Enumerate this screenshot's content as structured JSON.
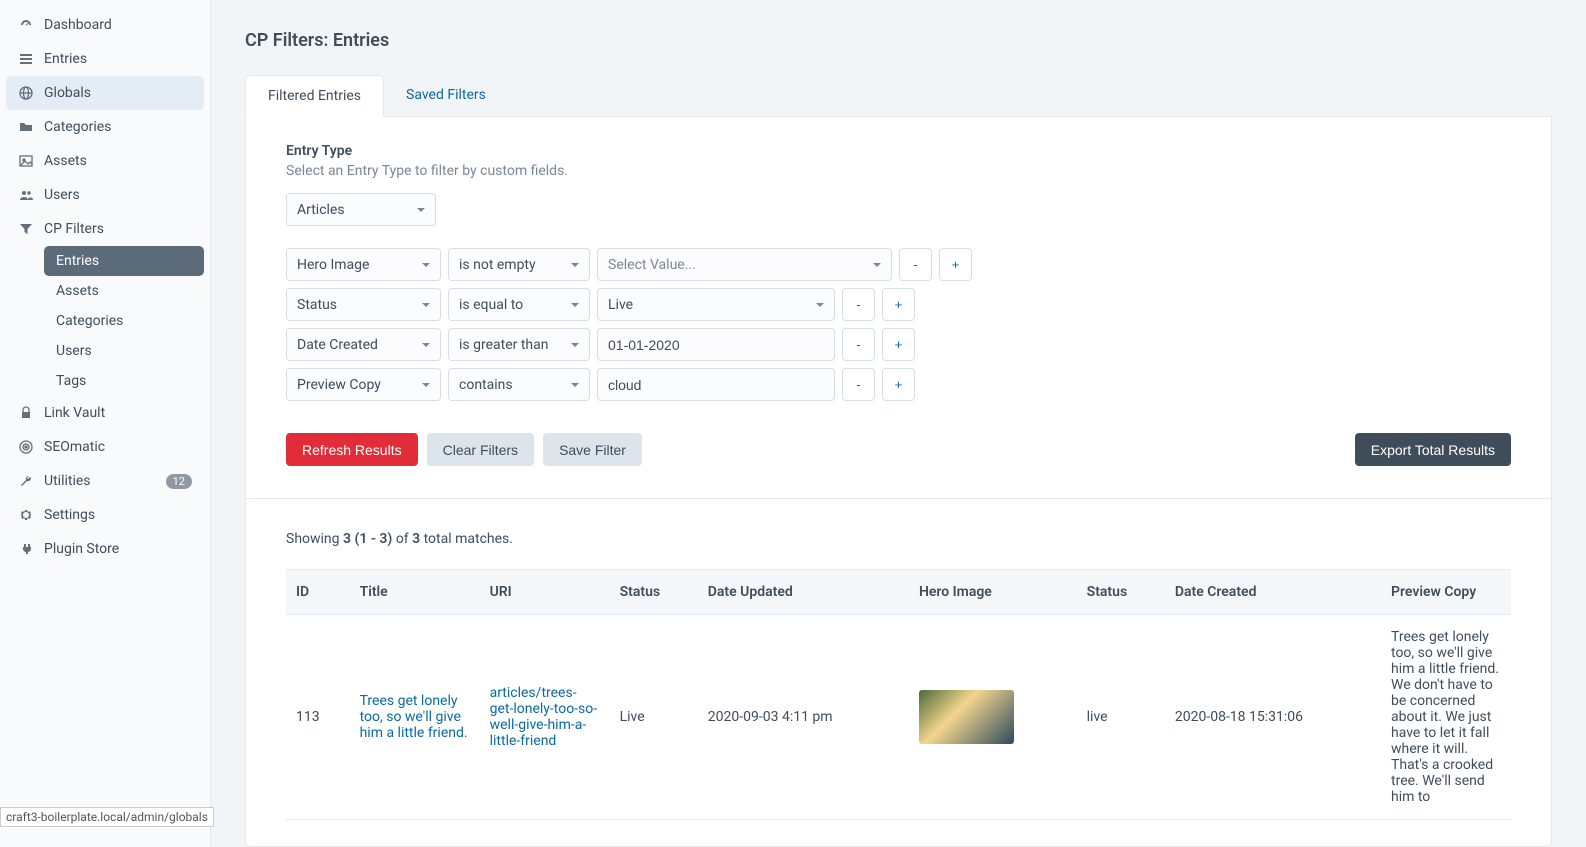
{
  "page_title": "CP Filters: Entries",
  "sidebar": {
    "items": [
      {
        "label": "Dashboard",
        "icon": "gauge"
      },
      {
        "label": "Entries",
        "icon": "list"
      },
      {
        "label": "Globals",
        "icon": "globe",
        "active": true
      },
      {
        "label": "Categories",
        "icon": "folder"
      },
      {
        "label": "Assets",
        "icon": "image"
      },
      {
        "label": "Users",
        "icon": "users"
      },
      {
        "label": "CP Filters",
        "icon": "filter",
        "sub": [
          {
            "label": "Entries",
            "active": true
          },
          {
            "label": "Assets"
          },
          {
            "label": "Categories"
          },
          {
            "label": "Users"
          },
          {
            "label": "Tags"
          }
        ]
      },
      {
        "label": "Link Vault",
        "icon": "lock"
      },
      {
        "label": "SEOmatic",
        "icon": "bullseye"
      },
      {
        "label": "Utilities",
        "icon": "wrench",
        "badge": "12"
      },
      {
        "label": "Settings",
        "icon": "gear"
      },
      {
        "label": "Plugin Store",
        "icon": "plug"
      }
    ]
  },
  "tabs": [
    {
      "label": "Filtered Entries",
      "active": true
    },
    {
      "label": "Saved Filters"
    }
  ],
  "entry_type": {
    "title": "Entry Type",
    "desc": "Select an Entry Type to filter by custom fields.",
    "value": "Articles"
  },
  "filters": [
    {
      "field": "Hero Image",
      "op": "is not empty",
      "val_type": "select",
      "val": "Select Value...",
      "wide": true
    },
    {
      "field": "Status",
      "op": "is equal to",
      "val_type": "select",
      "val": "Live"
    },
    {
      "field": "Date Created",
      "op": "is greater than",
      "val_type": "text",
      "val": "01-01-2020"
    },
    {
      "field": "Preview Copy",
      "op": "contains",
      "val_type": "text",
      "val": "cloud"
    }
  ],
  "buttons": {
    "refresh": "Refresh Results",
    "clear": "Clear Filters",
    "save": "Save Filter",
    "export": "Export Total Results",
    "minus": "-",
    "plus": "+"
  },
  "summary": {
    "prefix": "Showing ",
    "count": "3 (1 - 3)",
    "mid": " of ",
    "total": "3",
    "suffix": " total matches."
  },
  "table": {
    "headers": [
      "ID",
      "Title",
      "URI",
      "Status",
      "Date Updated",
      "Hero Image",
      "Status",
      "Date Created",
      "Preview Copy"
    ],
    "rows": [
      {
        "id": "113",
        "title": "Trees get lonely too, so we'll give him a little friend.",
        "uri": "articles/trees-get-lonely-too-so-well-give-him-a-little-friend",
        "status1": "Live",
        "date_updated": "2020-09-03 4:11 pm",
        "status2": "live",
        "date_created": "2020-08-18 15:31:06",
        "preview": "Trees get lonely too, so we'll give him a little friend. We don't have to be concerned about it. We just have to let it fall where it will. That's a crooked tree. We'll send him to"
      }
    ]
  },
  "status_url": "craft3-boilerplate.local/admin/globals"
}
